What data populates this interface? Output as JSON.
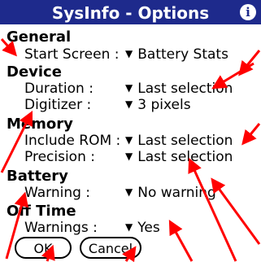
{
  "title": "SysInfo - Options",
  "info_icon": "i",
  "sections": [
    {
      "header": "General",
      "rows": [
        {
          "label": "Start Screen :",
          "value": "Battery Stats"
        }
      ]
    },
    {
      "header": "Device",
      "rows": [
        {
          "label": "Duration :",
          "value": "Last selection"
        },
        {
          "label": "Digitizer :",
          "value": "3 pixels"
        }
      ]
    },
    {
      "header": "Memory",
      "rows": [
        {
          "label": "Include ROM :",
          "value": "Last selection"
        },
        {
          "label": "Precision :",
          "value": "Last selection"
        }
      ]
    },
    {
      "header": "Battery",
      "rows": [
        {
          "label": "Warning :",
          "value": "No warning"
        }
      ]
    },
    {
      "header": "Off Time",
      "rows": [
        {
          "label": "Warnings :",
          "value": "Yes"
        }
      ]
    }
  ],
  "buttons": {
    "ok": "OK",
    "cancel": "Cancel"
  },
  "colors": {
    "titlebar": "#1e2a8c",
    "annotation_arrow": "#ff0000"
  },
  "icons": {
    "dropdown": "triangle-down-icon",
    "info": "info-icon"
  }
}
